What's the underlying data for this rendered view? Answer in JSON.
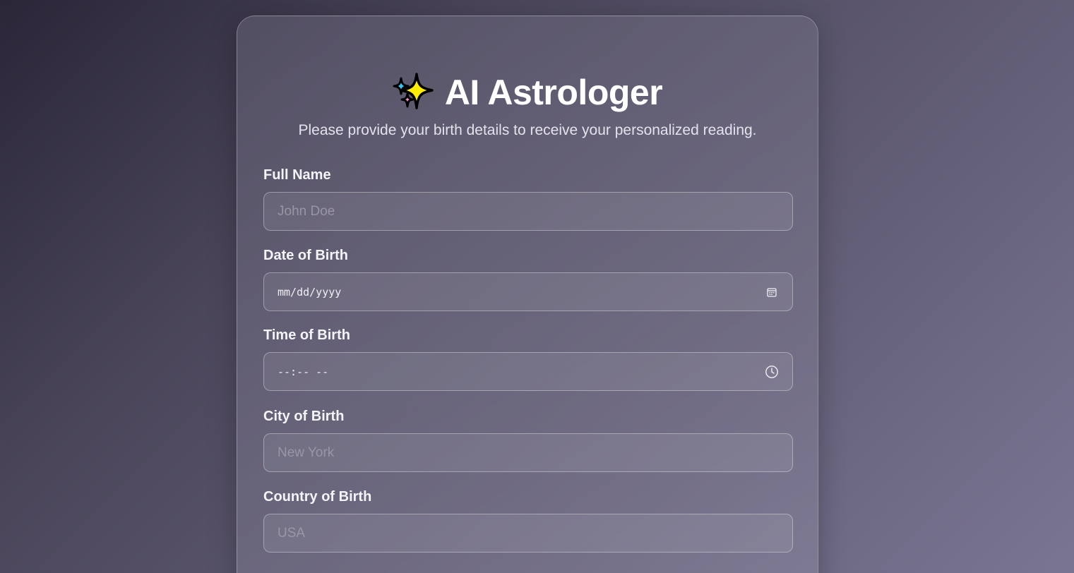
{
  "header": {
    "title": "AI Astrologer",
    "subtitle": "Please provide your birth details to receive your personalized reading.",
    "icon": "sparkles-icon"
  },
  "form": {
    "full_name": {
      "label": "Full Name",
      "placeholder": "John Doe",
      "value": ""
    },
    "date_of_birth": {
      "label": "Date of Birth",
      "format": "mm/dd/yyyy",
      "icon": "calendar-icon"
    },
    "time_of_birth": {
      "label": "Time of Birth",
      "format": "--:-- --",
      "icon": "clock-icon"
    },
    "city_of_birth": {
      "label": "City of Birth",
      "placeholder": "New York",
      "value": ""
    },
    "country_of_birth": {
      "label": "Country of Birth",
      "placeholder": "USA",
      "value": ""
    }
  },
  "colors": {
    "background_start": "#2a2638",
    "background_end": "#7a7593",
    "text": "#ffffff"
  }
}
